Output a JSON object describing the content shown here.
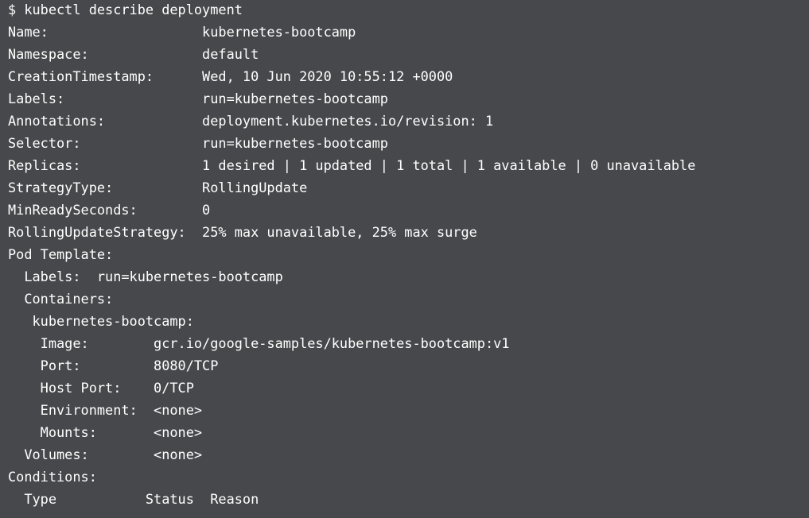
{
  "terminal": {
    "lines": [
      "$ kubectl describe deployment",
      "Name:                   kubernetes-bootcamp",
      "Namespace:              default",
      "CreationTimestamp:      Wed, 10 Jun 2020 10:55:12 +0000",
      "Labels:                 run=kubernetes-bootcamp",
      "Annotations:            deployment.kubernetes.io/revision: 1",
      "Selector:               run=kubernetes-bootcamp",
      "Replicas:               1 desired | 1 updated | 1 total | 1 available | 0 unavailable",
      "StrategyType:           RollingUpdate",
      "MinReadySeconds:        0",
      "RollingUpdateStrategy:  25% max unavailable, 25% max surge",
      "Pod Template:",
      "  Labels:  run=kubernetes-bootcamp",
      "  Containers:",
      "   kubernetes-bootcamp:",
      "    Image:        gcr.io/google-samples/kubernetes-bootcamp:v1",
      "    Port:         8080/TCP",
      "    Host Port:    0/TCP",
      "    Environment:  <none>",
      "    Mounts:       <none>",
      "  Volumes:        <none>",
      "Conditions:",
      "  Type           Status  Reason"
    ]
  }
}
